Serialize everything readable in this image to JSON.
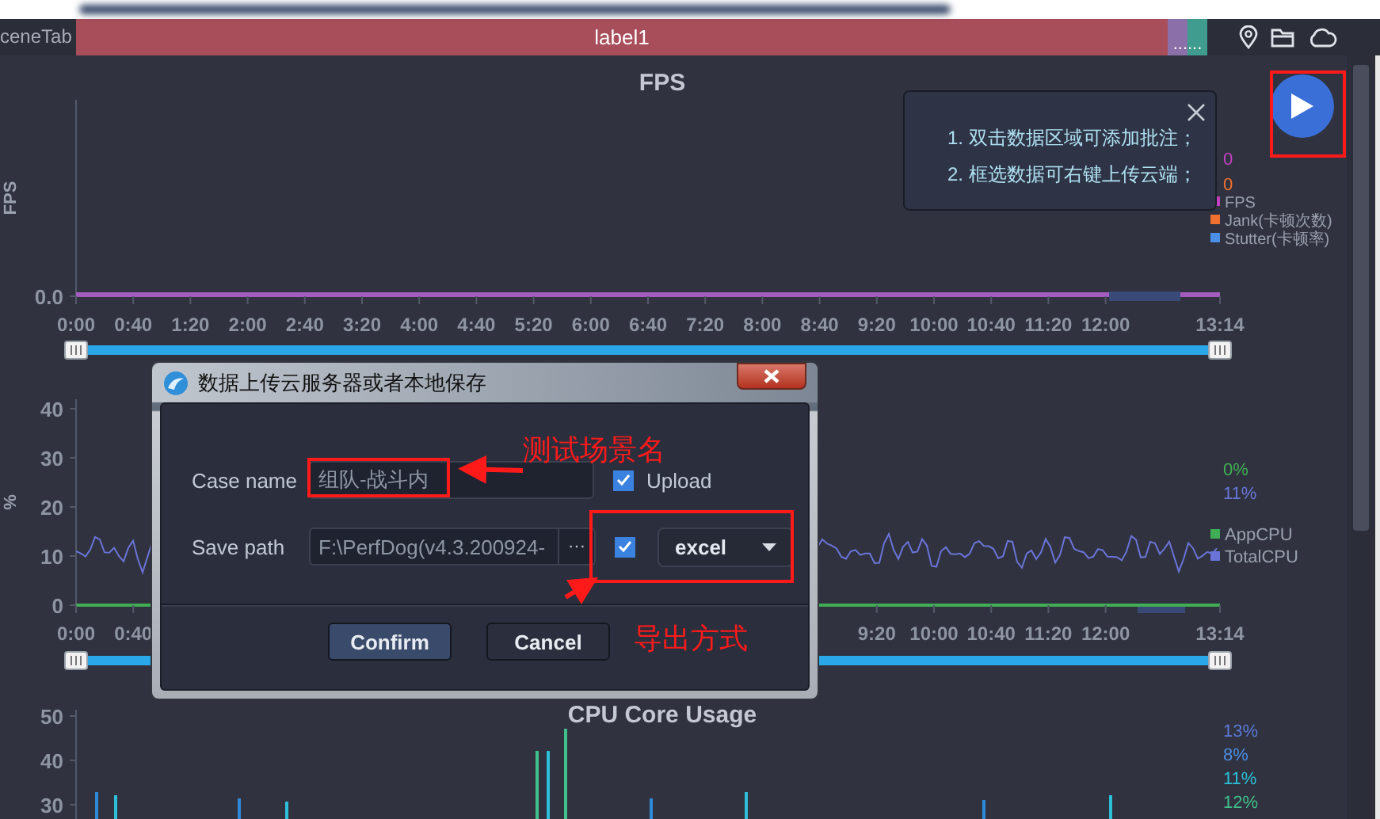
{
  "tab_bar": {
    "scene_tab": "ceneTab",
    "label": "label1",
    "overflow": "......"
  },
  "charts": [
    {
      "kind": "flat",
      "title": "FPS",
      "ylabel": "FPS",
      "yticks": [
        "0.0"
      ],
      "xticks": [
        "0:00",
        "0:40",
        "1:20",
        "2:00",
        "2:40",
        "3:20",
        "4:00",
        "4:40",
        "5:20",
        "6:00",
        "6:40",
        "7:20",
        "8:00",
        "8:40",
        "9:20",
        "10:00",
        "10:40",
        "11:20",
        "12:00",
        "13:14"
      ],
      "values": [
        {
          "text": "0",
          "color": "#c040c0"
        },
        {
          "text": "0",
          "color": "#f07030"
        }
      ],
      "legend": [
        {
          "label": "FPS",
          "color": "#c040c0"
        },
        {
          "label": "Jank(卡顿次数)",
          "color": "#f07030"
        },
        {
          "label": "Stutter(卡顿率)",
          "color": "#4a90e8"
        }
      ]
    },
    {
      "kind": "noise",
      "ylabel": "%",
      "yticks": [
        "40",
        "30",
        "20",
        "10",
        "0"
      ],
      "xticks": [
        "0:00",
        "0:40"
      ],
      "xticks_end": [
        "9:20",
        "10:00",
        "10:40",
        "11:20",
        "12:00",
        "13:14"
      ],
      "values": [
        {
          "text": "0%",
          "color": "#3fae54"
        },
        {
          "text": "11%",
          "color": "#6a74d8"
        }
      ],
      "legend": [
        {
          "label": "AppCPU",
          "color": "#3fae54"
        },
        {
          "label": "TotalCPU",
          "color": "#6a74d8"
        }
      ]
    },
    {
      "kind": "bars",
      "title": "CPU Core Usage",
      "yticks": [
        "50",
        "40",
        "30"
      ],
      "values": [
        {
          "text": "13%",
          "color": "#5b78d8"
        },
        {
          "text": "8%",
          "color": "#4c8ee8"
        },
        {
          "text": "11%",
          "color": "#2bc0d8"
        },
        {
          "text": "12%",
          "color": "#3fc08a"
        }
      ]
    }
  ],
  "tooltip": {
    "lines": [
      "1. 双击数据区域可添加批注；",
      "2. 框选数据可右键上传云端；"
    ]
  },
  "dialog": {
    "title": "数据上传云服务器或者本地保存",
    "case_name": {
      "label": "Case name",
      "value": "组队-战斗内"
    },
    "upload": {
      "label": "Upload",
      "checked": true
    },
    "save_path": {
      "label": "Save path",
      "value": "F:\\PerfDog(v4.3.200924-",
      "browse": "···"
    },
    "export": {
      "checked": true,
      "format": "excel"
    },
    "buttons": [
      {
        "label": "Confirm",
        "primary": true
      },
      {
        "label": "Cancel",
        "primary": false
      }
    ]
  },
  "annotations": [
    {
      "text": "测试场景名"
    },
    {
      "text": "导出方式"
    }
  ]
}
